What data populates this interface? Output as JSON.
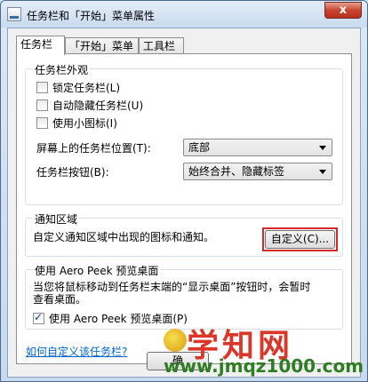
{
  "window": {
    "title": "任务栏和「开始」菜单属性",
    "close_glyph": "x"
  },
  "tabs": [
    {
      "label": "任务栏",
      "active": true
    },
    {
      "label": "「开始」菜单",
      "active": false
    },
    {
      "label": "工具栏",
      "active": false
    }
  ],
  "appearance": {
    "title": "任务栏外观",
    "lock": {
      "label": "锁定任务栏(L)",
      "checked": false
    },
    "autohide": {
      "label": "自动隐藏任务栏(U)",
      "checked": false
    },
    "small_icons": {
      "label": "使用小图标(I)",
      "checked": false
    },
    "position_label": "屏幕上的任务栏位置(T):",
    "position_value": "底部",
    "buttons_label": "任务栏按钮(B):",
    "buttons_value": "始终合并、隐藏标签"
  },
  "notification": {
    "title": "通知区域",
    "description": "自定义通知区域中出现的图标和通知。",
    "customize_button": "自定义(C)..."
  },
  "aero_peek": {
    "title": "使用 Aero Peek 预览桌面",
    "description_line1": "当您将鼠标移动到任务栏末端的“显示桌面”按钮时，会暂时",
    "description_line2": "查看桌面。",
    "checkbox_label": "使用 Aero Peek 预览桌面(P)",
    "checked": true
  },
  "help_link": "如何自定义该任务栏?",
  "footer": {
    "ok_button_partial": "确"
  },
  "watermark": {
    "name": "学知网",
    "url": "www.jmqz1000.com"
  },
  "colors": {
    "highlight": "#d9272e",
    "link": "#0066cc",
    "watermark_red": "#d9372a",
    "watermark_green": "#2e7d23"
  }
}
